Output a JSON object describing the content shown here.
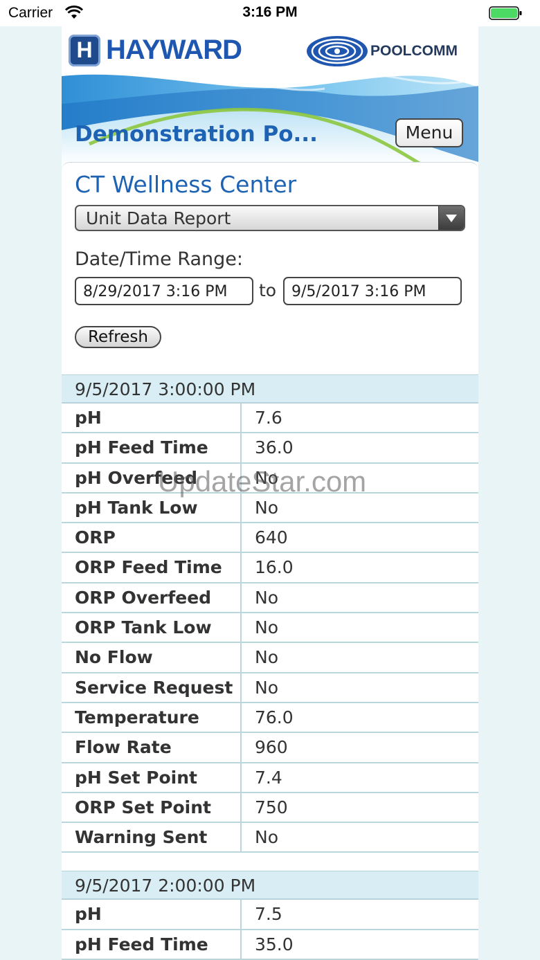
{
  "status_bar": {
    "carrier": "Carrier",
    "time": "3:16 PM"
  },
  "header": {
    "brand_logo_letter": "H",
    "brand_name": "HAYWARD",
    "product_name": "POOLCOMM",
    "site_title": "Demonstration Po...",
    "menu_label": "Menu"
  },
  "form": {
    "facility": "CT Wellness Center",
    "report_type": "Unit Data Report",
    "range_label": "Date/Time Range:",
    "from_value": "8/29/2017 3:16 PM",
    "to_label": "to",
    "to_value": "9/5/2017 3:16 PM",
    "refresh_label": "Refresh"
  },
  "report": {
    "groups": [
      {
        "timestamp": "9/5/2017 3:00:00 PM",
        "rows": [
          {
            "label": "pH",
            "value": "7.6"
          },
          {
            "label": "pH Feed Time",
            "value": "36.0"
          },
          {
            "label": "pH Overfeed",
            "value": "No"
          },
          {
            "label": "pH Tank Low",
            "value": "No"
          },
          {
            "label": "ORP",
            "value": "640"
          },
          {
            "label": "ORP Feed Time",
            "value": "16.0"
          },
          {
            "label": "ORP Overfeed",
            "value": "No"
          },
          {
            "label": "ORP Tank Low",
            "value": "No"
          },
          {
            "label": "No Flow",
            "value": "No"
          },
          {
            "label": "Service Request",
            "value": "No"
          },
          {
            "label": "Temperature",
            "value": "76.0"
          },
          {
            "label": "Flow Rate",
            "value": "960"
          },
          {
            "label": "pH Set Point",
            "value": "7.4"
          },
          {
            "label": "ORP Set Point",
            "value": "750"
          },
          {
            "label": "Warning Sent",
            "value": "No"
          }
        ]
      },
      {
        "timestamp": "9/5/2017 2:00:00 PM",
        "rows": [
          {
            "label": "pH",
            "value": "7.5"
          },
          {
            "label": "pH Feed Time",
            "value": "35.0"
          }
        ]
      }
    ]
  },
  "watermark": "UpdateStar.com",
  "colors": {
    "brand_blue": "#1e62b4",
    "page_background": "#e8f4f6",
    "group_header_bg": "#d9eef4",
    "battery_green": "#4cd964"
  }
}
